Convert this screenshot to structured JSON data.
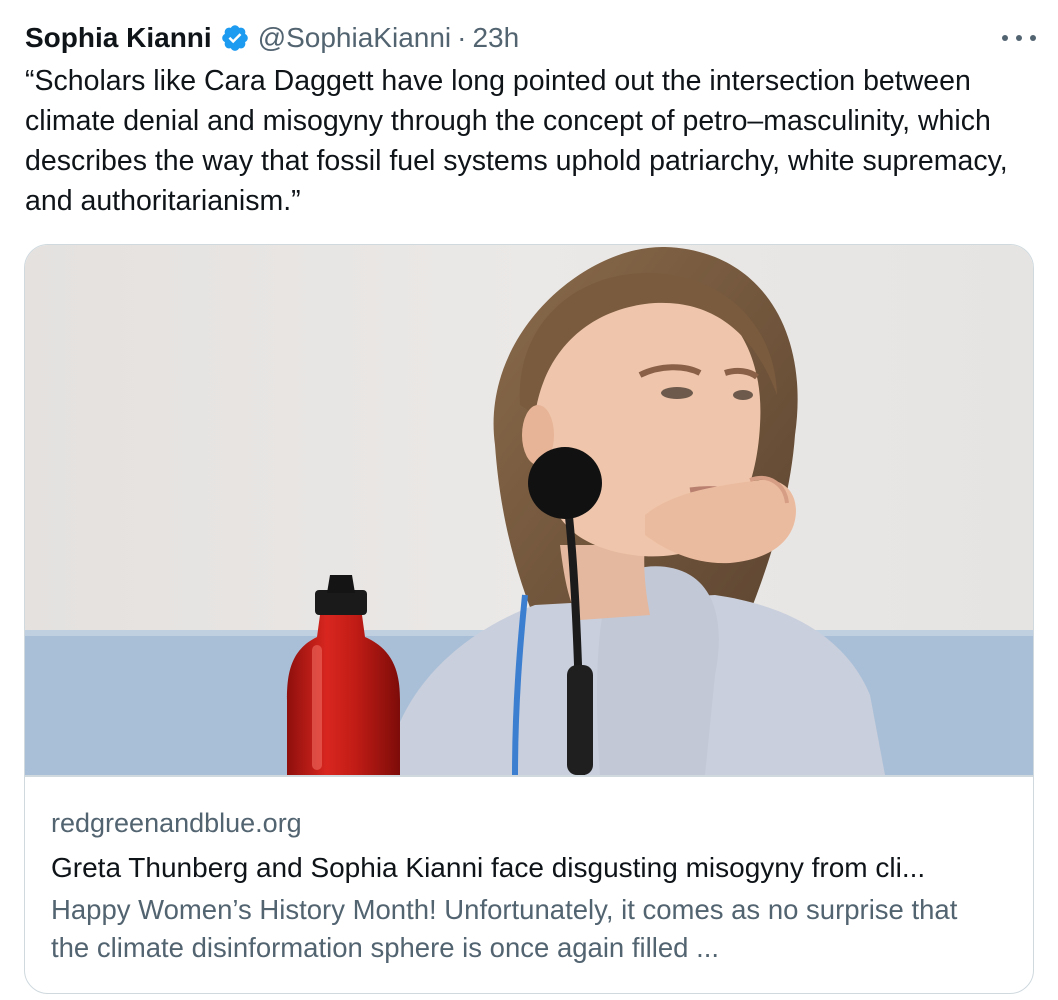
{
  "tweet": {
    "author_name": "Sophia Kianni",
    "handle": "@SophiaKianni",
    "separator": "·",
    "time": "23h",
    "verified": true,
    "text": "“Scholars like Cara Daggett have long pointed out the intersection between climate denial and misogyny through the concept of petro–masculinity, which describes the way that fossil fuel systems uphold patriarchy, white supremacy, and authoritarianism.”"
  },
  "card": {
    "domain": "redgreenandblue.org",
    "title": "Greta Thunberg and Sophia Kianni face disgusting misogyny from cli...",
    "description": "Happy Women’s History Month! Unfortunately, it comes as no surprise that the climate disinformation sphere is once again filled ..."
  },
  "icons": {
    "verified": "verified-badge-icon",
    "more": "more-options-icon"
  },
  "colors": {
    "verified_blue": "#1d9bf0",
    "secondary_text": "#536471",
    "border": "#cfd9de"
  }
}
